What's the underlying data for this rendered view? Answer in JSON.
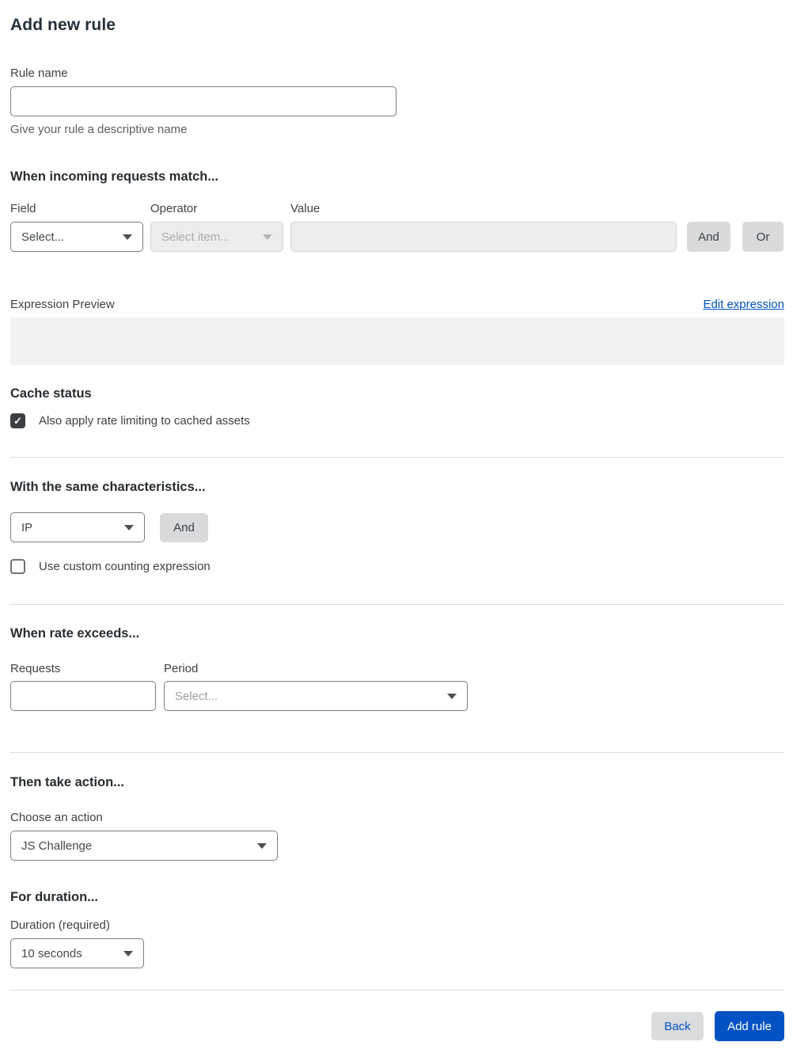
{
  "page": {
    "title": "Add new rule"
  },
  "rule_name": {
    "label": "Rule name",
    "value": "",
    "helper": "Give your rule a descriptive name"
  },
  "match_section": {
    "heading": "When incoming requests match...",
    "field": {
      "label": "Field",
      "selected": "Select..."
    },
    "operator": {
      "label": "Operator",
      "selected": "Select item..."
    },
    "value": {
      "label": "Value",
      "value": ""
    },
    "and_button": "And",
    "or_button": "Or"
  },
  "expression": {
    "label": "Expression Preview",
    "edit_link": "Edit expression",
    "content": ""
  },
  "cache_section": {
    "heading": "Cache status",
    "checkbox_label": "Also apply rate limiting to cached assets",
    "checked": true
  },
  "characteristics_section": {
    "heading": "With the same characteristics...",
    "characteristic": {
      "selected": "IP"
    },
    "and_button": "And",
    "checkbox_label": "Use custom counting expression",
    "checked": false
  },
  "rate_section": {
    "heading": "When rate exceeds...",
    "requests": {
      "label": "Requests",
      "value": ""
    },
    "period": {
      "label": "Period",
      "selected": "Select..."
    }
  },
  "action_section": {
    "heading": "Then take action...",
    "label": "Choose an action",
    "selected": "JS Challenge"
  },
  "duration_section": {
    "heading": "For duration...",
    "label": "Duration (required)",
    "selected": "10 seconds"
  },
  "footer": {
    "back_label": "Back",
    "add_label": "Add rule"
  },
  "icons": {
    "chevron": "chevron-down-icon",
    "check": "check-icon",
    "check_glyph": "✓"
  },
  "colors": {
    "primary_blue": "#0051c3",
    "link_blue": "#0051c3",
    "button_gray": "#d9dadb",
    "disabled_bg": "#ededee",
    "preview_bg": "#f2f2f2",
    "checkbox_checked": "#3b3f42",
    "heading_text": "#272d31",
    "divider": "#dcdddd"
  }
}
